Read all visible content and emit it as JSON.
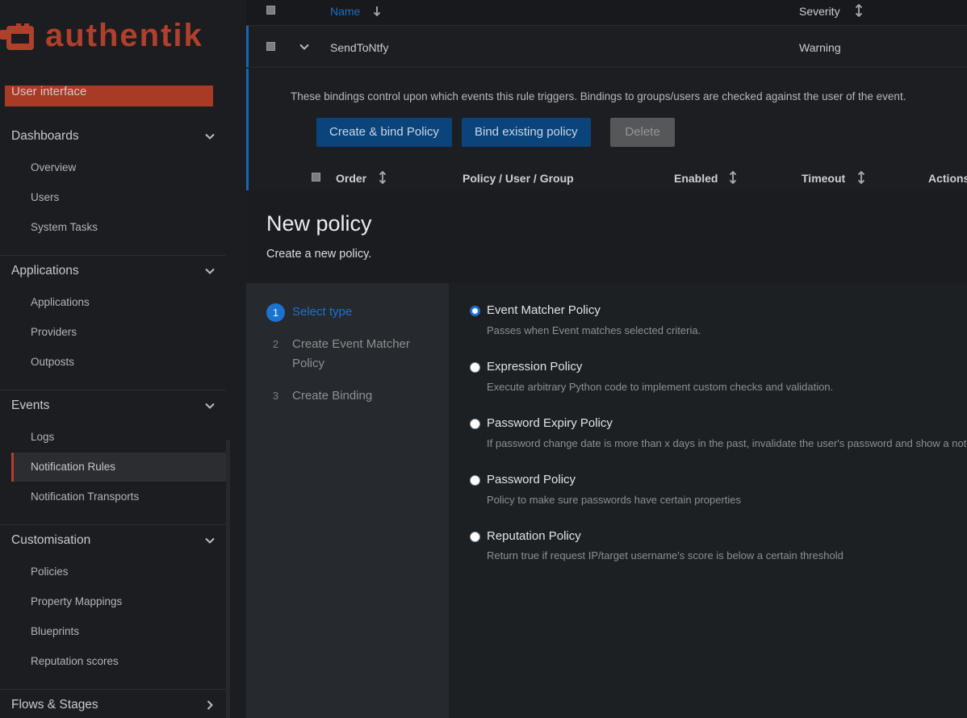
{
  "app": {
    "logo_text": "authentik",
    "brand_color": "#b0402b",
    "accent_color": "#1a73d1"
  },
  "sidebar": {
    "user_interface_label": "User interface",
    "sections": [
      {
        "label": "Dashboards",
        "chevron": "chevron-down-icon",
        "items": [
          "Overview",
          "Users",
          "System Tasks"
        ]
      },
      {
        "label": "Applications",
        "chevron": "chevron-down-icon",
        "items": [
          "Applications",
          "Providers",
          "Outposts"
        ]
      },
      {
        "label": "Events",
        "chevron": "chevron-down-icon",
        "items": [
          "Logs",
          "Notification Rules",
          "Notification Transports"
        ],
        "active_item": "Notification Rules"
      },
      {
        "label": "Customisation",
        "chevron": "chevron-down-icon",
        "items": [
          "Policies",
          "Property Mappings",
          "Blueprints",
          "Reputation scores"
        ]
      },
      {
        "label": "Flows & Stages",
        "chevron": "chevron-right-icon",
        "items": []
      }
    ]
  },
  "table": {
    "columns": {
      "name": "Name",
      "severity": "Severity"
    },
    "row": {
      "name": "SendToNtfy",
      "severity": "Warning"
    },
    "bindings_help": "These bindings control upon which events this rule triggers. Bindings to groups/users are checked against the user of the event.",
    "buttons": {
      "create_bind": "Create & bind Policy",
      "bind_existing": "Bind existing policy",
      "delete": "Delete"
    },
    "binding_columns": {
      "order": "Order",
      "target": "Policy / User / Group",
      "enabled": "Enabled",
      "timeout": "Timeout",
      "actions": "Actions"
    }
  },
  "modal": {
    "title": "New policy",
    "subtitle": "Create a new policy.",
    "steps": [
      {
        "number": "1",
        "label": "Select type",
        "current": true
      },
      {
        "number": "2",
        "label": "Create Event Matcher Policy",
        "current": false
      },
      {
        "number": "3",
        "label": "Create Binding",
        "current": false
      }
    ],
    "options": [
      {
        "title": "Event Matcher Policy",
        "description": "Passes when Event matches selected criteria.",
        "selected": true
      },
      {
        "title": "Expression Policy",
        "description": "Execute arbitrary Python code to implement custom checks and validation.",
        "selected": false
      },
      {
        "title": "Password Expiry Policy",
        "description": "If password change date is more than x days in the past, invalidate the user's password and show a notice",
        "selected": false
      },
      {
        "title": "Password Policy",
        "description": "Policy to make sure passwords have certain properties",
        "selected": false
      },
      {
        "title": "Reputation Policy",
        "description": "Return true if request IP/target username's score is below a certain threshold",
        "selected": false
      }
    ]
  }
}
